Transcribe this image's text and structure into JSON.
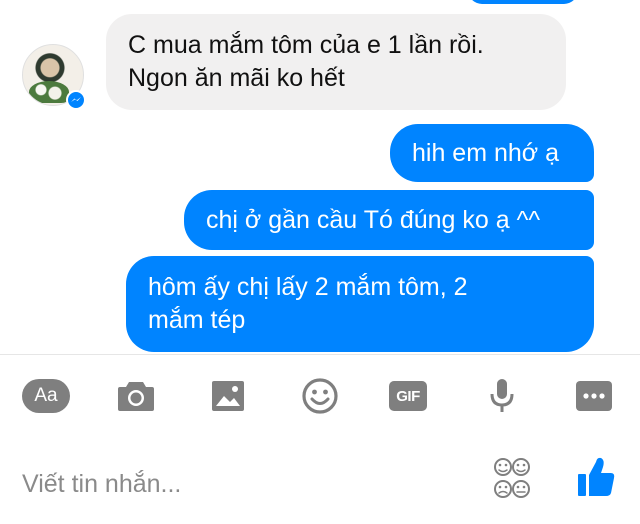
{
  "conversation": {
    "messages": [
      {
        "direction": "incoming",
        "lines": [
          "C mua mắm tôm của e 1 lần rồi.",
          "Ngon ăn mãi ko hết"
        ]
      },
      {
        "direction": "outgoing",
        "lines": [
          "hih em nhớ ạ"
        ]
      },
      {
        "direction": "outgoing",
        "lines": [
          "chị ở gần cầu Tó đúng ko ạ ^^"
        ]
      },
      {
        "direction": "outgoing",
        "lines": [
          "hôm ấy chị lấy 2 mắm tôm, 2",
          "mắm tép"
        ]
      }
    ]
  },
  "toolbar": {
    "text_style_label": "Aa",
    "gif_label": "GIF",
    "icons": [
      "text-style-icon",
      "camera-icon",
      "image-icon",
      "emoji-icon",
      "gif-icon",
      "microphone-icon",
      "more-icon"
    ]
  },
  "composer": {
    "placeholder": "Viết tin nhắn...",
    "value": ""
  },
  "colors": {
    "outgoing_bubble": "#0084ff",
    "incoming_bubble": "#f1f0f0",
    "icon_gray": "#7f7f7f",
    "like_blue": "#0084ff"
  }
}
